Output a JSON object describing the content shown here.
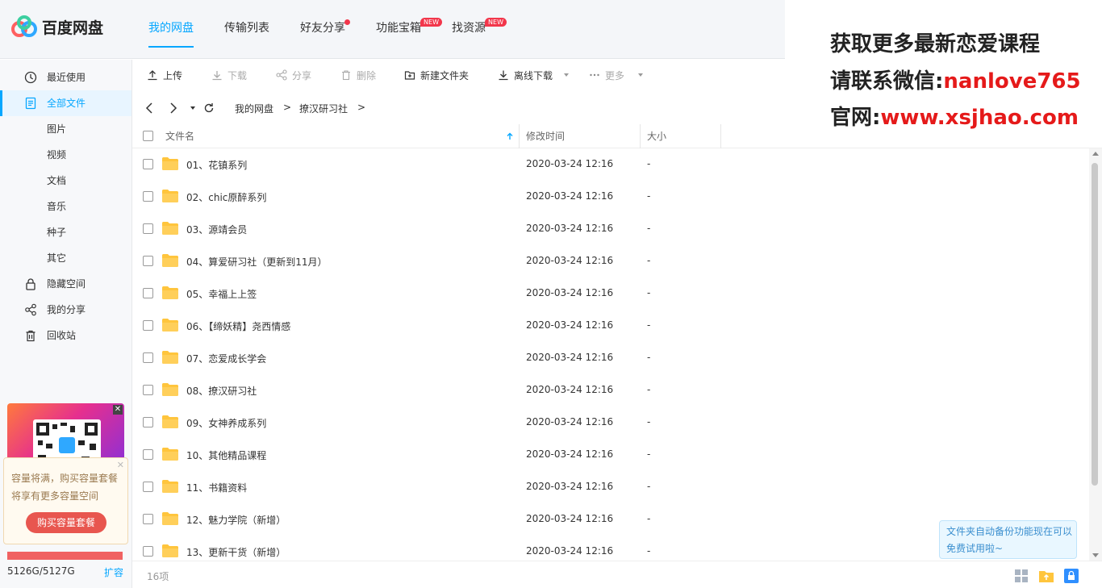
{
  "app": {
    "name": "百度网盘"
  },
  "nav": [
    {
      "label": "我的网盘",
      "active": true
    },
    {
      "label": "传输列表"
    },
    {
      "label": "好友分享",
      "dot": true
    },
    {
      "label": "功能宝箱",
      "badge": "NEW"
    },
    {
      "label": "找资源",
      "badge": "NEW"
    }
  ],
  "promo": {
    "line1": "获取更多最新恋爱课程",
    "line2_prefix": "请联系微信:",
    "line2_value": "nanlove765",
    "line3_prefix": "官网:",
    "line3_value": "www.xsjhao.com"
  },
  "sidebar": {
    "items": [
      {
        "label": "最近使用",
        "icon": "clock-icon"
      },
      {
        "label": "全部文件",
        "icon": "document-icon",
        "active": true
      },
      {
        "label": "图片"
      },
      {
        "label": "视频"
      },
      {
        "label": "文档"
      },
      {
        "label": "音乐"
      },
      {
        "label": "种子"
      },
      {
        "label": "其它"
      },
      {
        "label": "隐藏空间",
        "icon": "lock-icon"
      },
      {
        "label": "我的分享",
        "icon": "share-icon"
      },
      {
        "label": "回收站",
        "icon": "trash-icon"
      }
    ],
    "tip": {
      "text": "容量将满，购买容量套餐将享有更多容量空间",
      "button": "购买容量套餐"
    },
    "capacity": {
      "text": "5126G/5127G",
      "used_fraction": 0.9998,
      "expand": "扩容"
    }
  },
  "toolbar": {
    "upload": "上传",
    "download": "下载",
    "share": "分享",
    "delete": "删除",
    "new_folder": "新建文件夹",
    "offline": "离线下载",
    "more": "更多"
  },
  "path": {
    "root": "我的网盘",
    "sep": ">",
    "current": "撩汉研习社",
    "trail": ">"
  },
  "table": {
    "col_name": "文件名",
    "col_date": "修改时间",
    "col_size": "大小",
    "rows": [
      {
        "name": "01、花镇系列",
        "date": "2020-03-24 12:16",
        "size": "-"
      },
      {
        "name": "02、chic原醉系列",
        "date": "2020-03-24 12:16",
        "size": "-"
      },
      {
        "name": "03、源靖会员",
        "date": "2020-03-24 12:16",
        "size": "-"
      },
      {
        "name": "04、算爱研习社（更新到11月）",
        "date": "2020-03-24 12:16",
        "size": "-"
      },
      {
        "name": "05、幸福上上签",
        "date": "2020-03-24 12:16",
        "size": "-"
      },
      {
        "name": "06、【缔妖精】尧西情感",
        "date": "2020-03-24 12:16",
        "size": "-"
      },
      {
        "name": "07、恋爱成长学会",
        "date": "2020-03-24 12:16",
        "size": "-"
      },
      {
        "name": "08、撩汉研习社",
        "date": "2020-03-24 12:16",
        "size": "-"
      },
      {
        "name": "09、女神养成系列",
        "date": "2020-03-24 12:16",
        "size": "-"
      },
      {
        "name": "10、其他精品课程",
        "date": "2020-03-24 12:16",
        "size": "-"
      },
      {
        "name": "11、书籍资料",
        "date": "2020-03-24 12:16",
        "size": "-"
      },
      {
        "name": "12、魅力学院（新增）",
        "date": "2020-03-24 12:16",
        "size": "-"
      },
      {
        "name": "13、更新干货（新增）",
        "date": "2020-03-24 12:16",
        "size": "-"
      }
    ]
  },
  "footer": {
    "count": "16项",
    "backup_tip": "文件夹自动备份功能现在可以免费试用啦~"
  },
  "colors": {
    "accent": "#06a7ff",
    "folder": "#ffc53d",
    "red": "#e51a1a"
  }
}
